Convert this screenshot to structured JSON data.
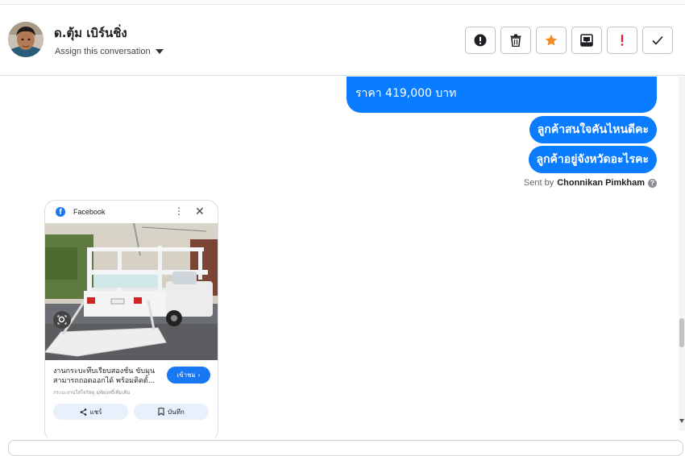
{
  "header": {
    "name": "ด.ตุ้ม เบิร์นชิ่ง",
    "assign_label": "Assign this conversation"
  },
  "actions": [
    {
      "icon": "alert-circle-icon"
    },
    {
      "icon": "trash-icon"
    },
    {
      "icon": "star-icon",
      "color": "#f58b22"
    },
    {
      "icon": "archive-inbox-icon"
    },
    {
      "icon": "exclamation-icon",
      "color": "#e41e3f"
    },
    {
      "icon": "check-icon"
    }
  ],
  "messages": {
    "price": "ราคา 419,000 บาท",
    "q1": "ลูกค้าสนใจคันไหนดีคะ",
    "q2": "ลูกค้าอยู่จังหวัดอะไรคะ",
    "sent_by_prefix": "Sent by",
    "sent_by_name": "Chonnikan Pimkham"
  },
  "card": {
    "source": "Facebook",
    "caption_line1": "งานกระบะทึบเรียบสองชั้น ขับมุน",
    "caption_line2": "สามารถถอดออกได้ พร้อมติดตั้...",
    "caption_sub": "กระบะงานใส่ใจรัสดุ อุทัยฤทธิ์เพิ่มเติม",
    "more_label": "เข้าชม",
    "share_label": "แชร์",
    "save_label": "บันทึก"
  },
  "colors": {
    "bubble": "#0a7cff",
    "accent": "#1877f2"
  }
}
